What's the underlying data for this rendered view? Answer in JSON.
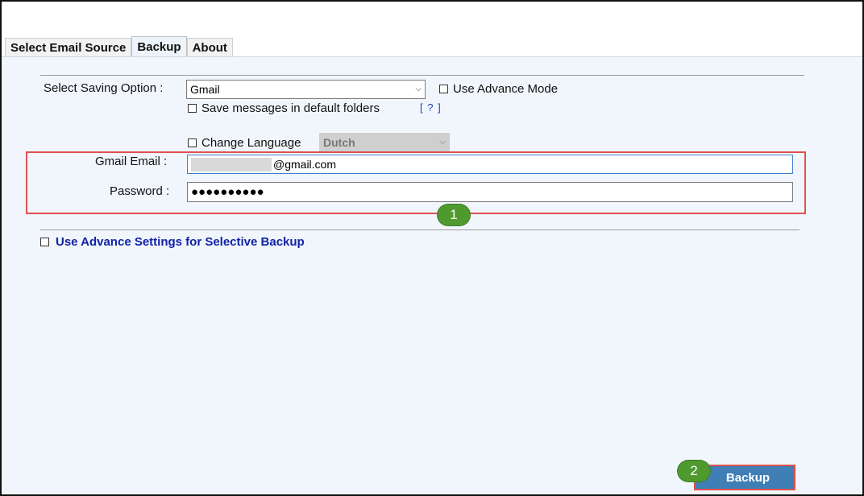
{
  "tabs": [
    {
      "label": "Select Email Source"
    },
    {
      "label": "Backup"
    },
    {
      "label": "About"
    }
  ],
  "saving": {
    "label": "Select Saving Option :",
    "value": "Gmail",
    "advance_mode": "Use Advance Mode",
    "default_folders": "Save messages in default folders",
    "help": "[ ? ]",
    "change_language": "Change Language",
    "language_value": "Dutch"
  },
  "login": {
    "email_label": "Gmail Email :",
    "email_suffix": "@gmail.com",
    "password_label": "Password :",
    "password_value": "●●●●●●●●●●"
  },
  "advanced_settings": "Use Advance Settings for Selective Backup",
  "badges": [
    "1",
    "2"
  ],
  "backup_button": "Backup",
  "colors": {
    "highlight": "#e05050",
    "badge": "#4f9a2f",
    "button": "#3f7fb6",
    "link": "#1122a8"
  }
}
